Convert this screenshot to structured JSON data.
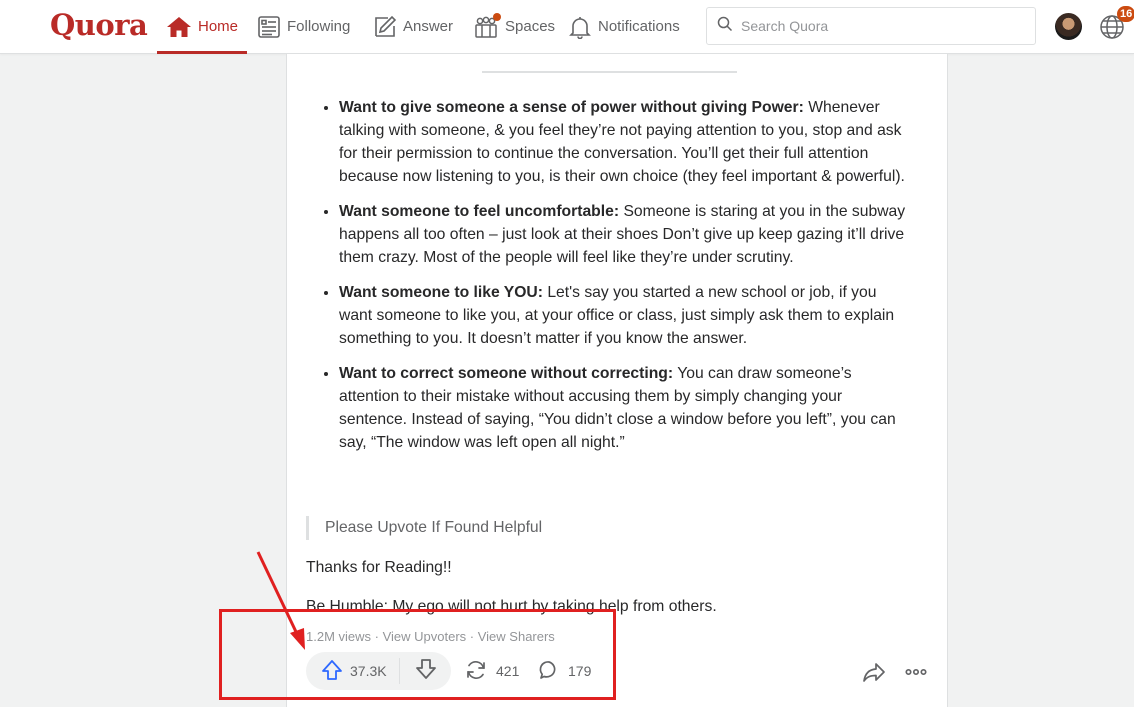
{
  "brand": {
    "logo_text": "Quora",
    "accent": "#b92b27"
  },
  "nav": {
    "home": "Home",
    "following": "Following",
    "answer": "Answer",
    "spaces": "Spaces",
    "notifications": "Notifications"
  },
  "search": {
    "placeholder": "Search Quora"
  },
  "header_right": {
    "globe_badge": "16"
  },
  "answer": {
    "points": [
      {
        "title": "Want to give someone a sense of power without giving Power:",
        "text": "Whenever talking with someone, & you feel they’re not paying attention to you, stop and ask for their permission to continue the conversation. You’ll get their full attention because now listening to you, is their own choice (they feel important & powerful)."
      },
      {
        "title": "Want someone to feel uncomfortable:",
        "text": "Someone is staring at you in the subway happens all too often – just look at their shoes Don’t give up keep gazing it’ll drive them crazy. Most of the people will feel like they’re under scrutiny."
      },
      {
        "title": "Want someone to like YOU:",
        "text": "Let's say you started a new school or job, if you want someone to like you, at your office or class, just simply ask them to explain something to you. It doesn’t matter if you know the answer."
      },
      {
        "title": "Want to correct someone without correcting:",
        "text": "You can draw someone’s attention to their mistake without accusing them by simply changing your sentence. Instead of saying, “You didn’t close a window before you left”, you can say, “The window was left open all night.”"
      }
    ],
    "quote": "Please Upvote If Found Helpful",
    "thanks": "Thanks for Reading!!",
    "humble": "Be Humble: My ego will not hurt by taking help from others.",
    "meta": {
      "views": "1.2M views",
      "sep1": " · ",
      "upvoters": "View Upvoters",
      "sep2": " · ",
      "sharers": "View Sharers"
    },
    "actions": {
      "upvotes": "37.3K",
      "shares": "421",
      "comments": "179"
    }
  },
  "annotation": {
    "box_color": "#e02020"
  }
}
